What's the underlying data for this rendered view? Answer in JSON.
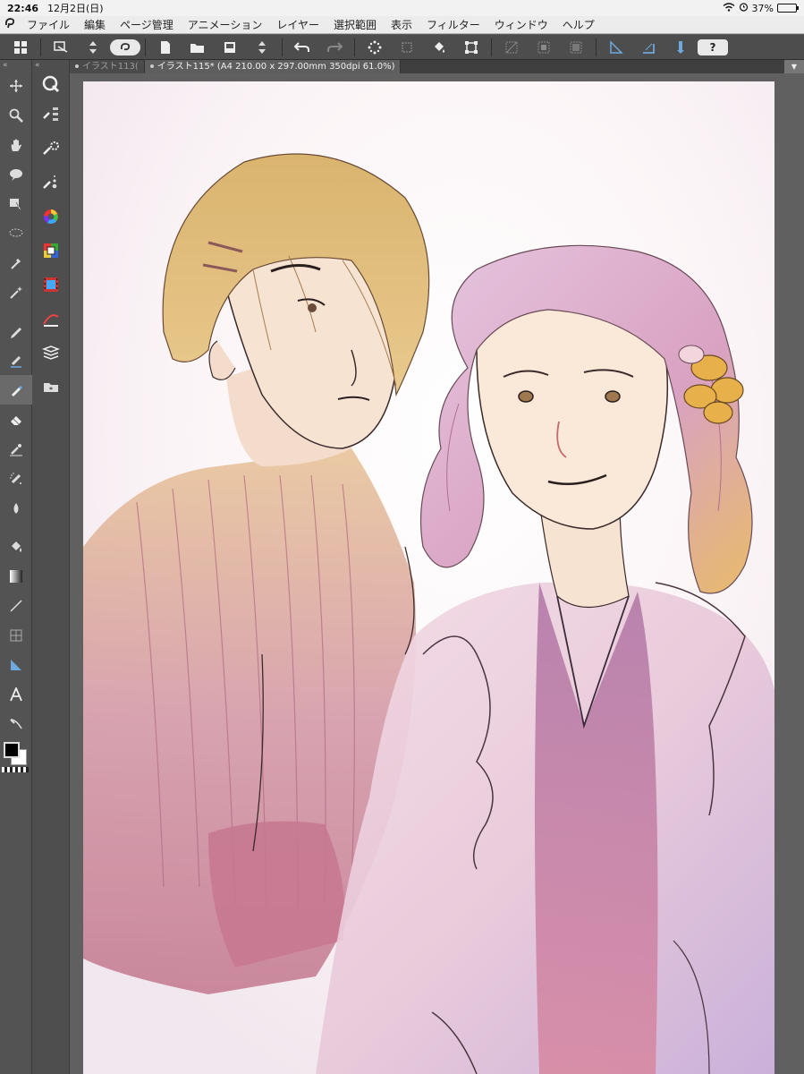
{
  "status_bar": {
    "time": "22:46",
    "date": "12月2日(日)",
    "battery": "37%",
    "battery_level": 0.37
  },
  "menu_bar": {
    "logo_icon": "clip-studio-logo-icon",
    "items": [
      "ファイル",
      "編集",
      "ページ管理",
      "アニメーション",
      "レイヤー",
      "選択範囲",
      "表示",
      "フィルター",
      "ウィンドウ",
      "ヘルプ"
    ]
  },
  "command_bar": {
    "help_label": "?"
  },
  "tabs": [
    {
      "label": "イラスト113("
    },
    {
      "label": "イラスト115* (A4 210.00 x 297.00mm 350dpi 61.0%)"
    }
  ],
  "colors": {
    "main_color": "#000000",
    "sub_color": "#ffffff",
    "ui_dark": "#4d4d4d",
    "accent_blue": "#6fa8dc"
  }
}
